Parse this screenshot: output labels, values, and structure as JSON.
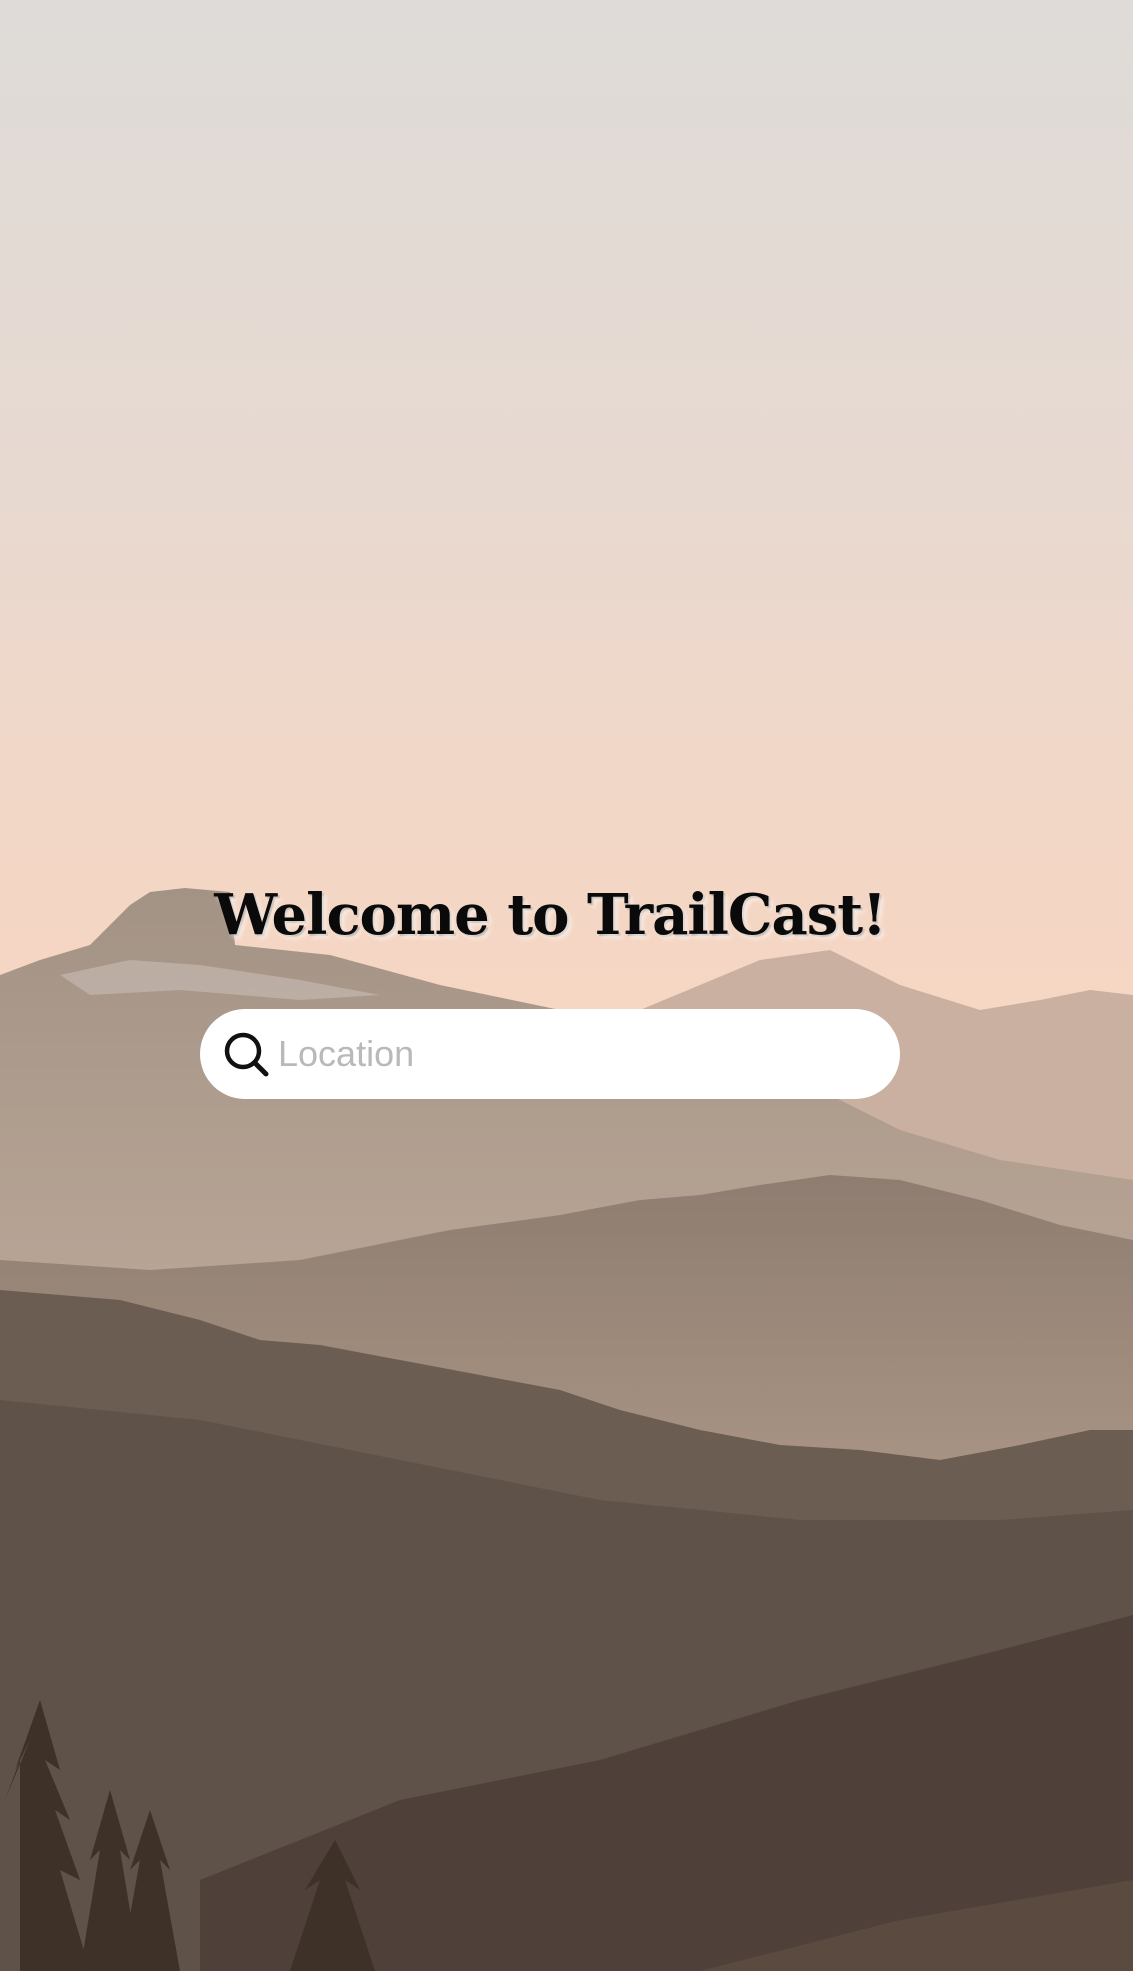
{
  "hero": {
    "title": "Welcome to TrailCast!"
  },
  "search": {
    "placeholder": "Location",
    "value": "",
    "icon": "search-icon"
  },
  "colors": {
    "sky_top": "#dedbd8",
    "sky_bottom": "#f8d8c2",
    "title_text": "#0b0a0a",
    "search_bg": "#ffffff",
    "placeholder_text": "#b9b9b9"
  }
}
